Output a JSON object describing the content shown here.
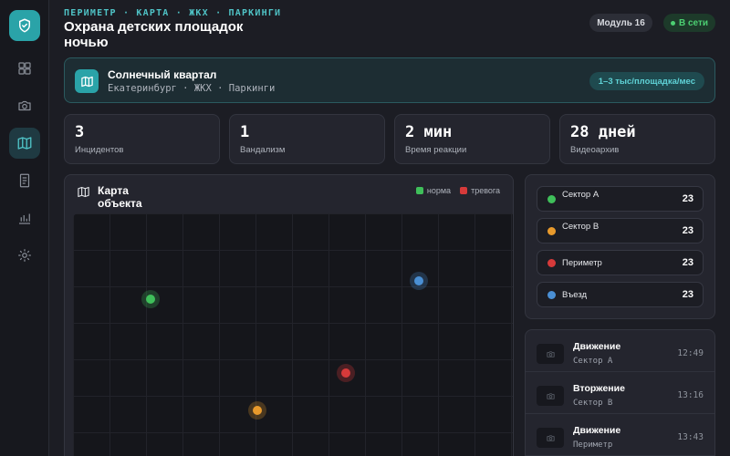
{
  "header": {
    "breadcrumb": "ПЕРИМЕТР · КАРТА · ЖКХ · ПАРКИНГИ",
    "title": "Охрана детских площадок ночью",
    "module": "Модуль 16",
    "status": "В сети"
  },
  "banner": {
    "title": "Солнечный квартал",
    "subtitle": "Екатеринбург · ЖКХ · Паркинги",
    "tag": "1–3 тыс/площадка/мес"
  },
  "stats": [
    {
      "value": "3",
      "label": "Инцидентов"
    },
    {
      "value": "1",
      "label": "Вандализм"
    },
    {
      "value": "2 мин",
      "label": "Время реакции"
    },
    {
      "value": "28 дней",
      "label": "Видеоархив"
    }
  ],
  "map": {
    "title": "Карта объекта",
    "legend": [
      {
        "label": "норма",
        "color": "#3fbf5a"
      },
      {
        "label": "тревога",
        "color": "#d63a3a"
      }
    ],
    "markers": [
      {
        "name": "green",
        "color": "#3fbf5a"
      },
      {
        "name": "blue",
        "color": "#4a8fd4"
      },
      {
        "name": "red",
        "color": "#d63a3a"
      },
      {
        "name": "orange",
        "color": "#e89a2c"
      }
    ]
  },
  "sectors": [
    {
      "name": "Сектор А",
      "count": "23",
      "color": "#3fbf5a"
    },
    {
      "name": "Сектор В",
      "count": "23",
      "color": "#e89a2c"
    },
    {
      "name": "Периметр",
      "count": "23",
      "color": "#d63a3a"
    },
    {
      "name": "Въезд",
      "count": "23",
      "color": "#4a8fd4"
    }
  ],
  "events": [
    {
      "title": "Движение",
      "sub": "Сектор А",
      "time": "12:49"
    },
    {
      "title": "Вторжение",
      "sub": "Сектор В",
      "time": "13:16"
    },
    {
      "title": "Движение",
      "sub": "Периметр",
      "time": "13:43"
    }
  ],
  "sidebar": {
    "icons": [
      "shield-icon",
      "dashboard-icon",
      "camera-icon",
      "map-icon",
      "document-icon",
      "chart-icon",
      "gear-icon"
    ]
  }
}
